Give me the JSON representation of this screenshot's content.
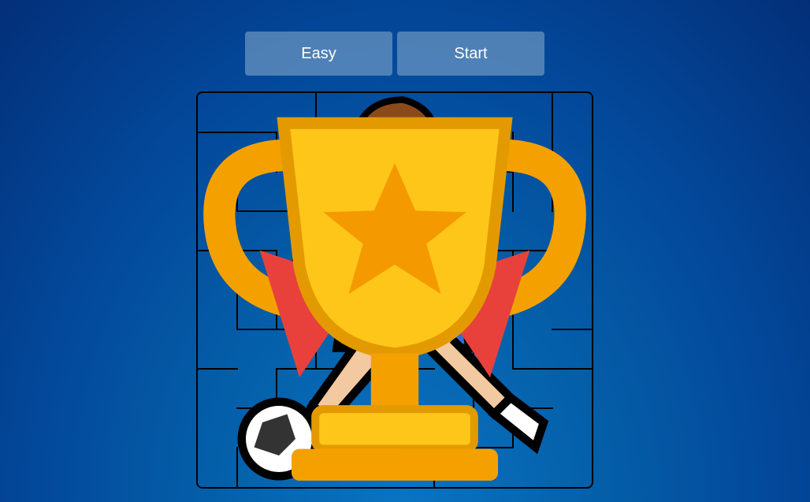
{
  "controls": {
    "difficulty_label": "Easy",
    "start_label": "Start"
  },
  "maze": {
    "rows": 10,
    "cols": 10,
    "wall_color": "#000000",
    "player_icon": "soccer-player-icon",
    "goal_icon": "trophy-icon"
  }
}
